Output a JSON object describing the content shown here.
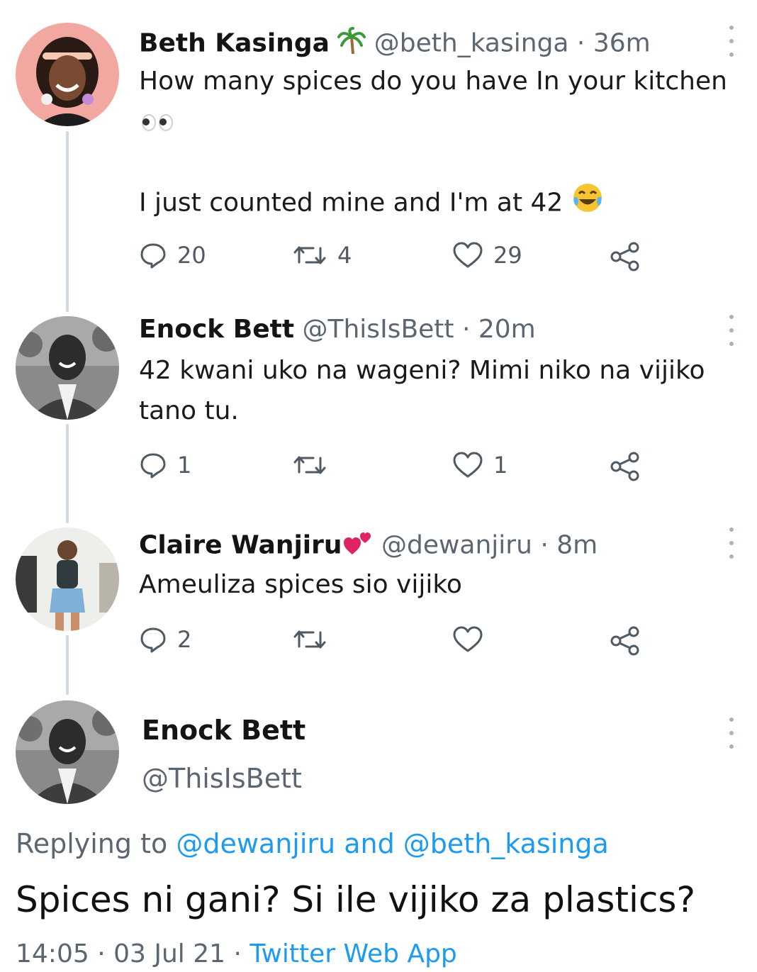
{
  "accent_color": "#1d9bf0",
  "tweets": [
    {
      "name": "Beth Kasinga",
      "name_emoji": "palm-tree-emoji",
      "handle": "@beth_kasinga",
      "separator": "·",
      "time": "36m",
      "text_line1": "How many spices do you have In your kitchen",
      "text_line2_emoji": "eyes-emoji",
      "text_line3": "I just counted mine and I'm at 42",
      "text_line3_emoji": "tears-of-joy-emoji",
      "replies": "20",
      "retweets": "4",
      "likes": "29"
    },
    {
      "name": "Enock Bett",
      "handle": "@ThisIsBett",
      "separator": "·",
      "time": "20m",
      "text_line1": "42 kwani uko na wageni? Mimi niko na vijiko",
      "text_line2": "tano tu.",
      "replies": "1",
      "retweets": "",
      "likes": "1"
    },
    {
      "name": "Claire Wanjiru",
      "name_emoji": "hearts-emoji",
      "handle": "@dewanjiru",
      "separator": "·",
      "time": "8m",
      "text_line1": "Ameuliza spices sio vijiko",
      "replies": "2",
      "retweets": "",
      "likes": ""
    }
  ],
  "main_tweet": {
    "name": "Enock Bett",
    "handle": "@ThisIsBett",
    "replying_prefix": "Replying to",
    "replying_mention1": "@dewanjiru",
    "replying_and": "and",
    "replying_mention2": "@beth_kasinga",
    "text": "Spices ni gani? Si ile vijiko za plastics?",
    "time": "14:05",
    "separator1": "·",
    "date": "03 Jul 21",
    "separator2": "·",
    "source": "Twitter Web App"
  }
}
